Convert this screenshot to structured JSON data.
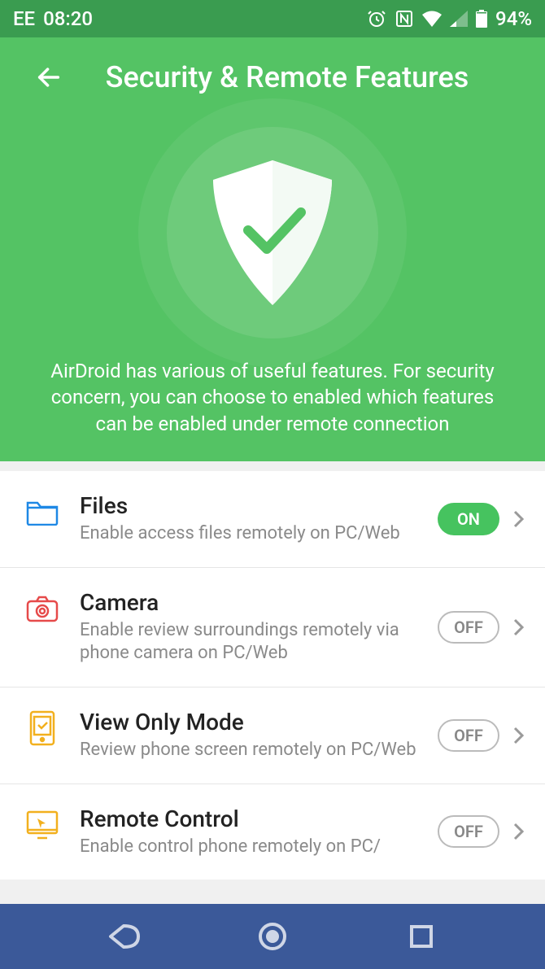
{
  "status_bar": {
    "carrier": "EE",
    "time": "08:20",
    "battery_percent": "94%"
  },
  "header": {
    "title": "Security & Remote Features"
  },
  "hero": {
    "description": "AirDroid has various of useful features. For security concern, you can choose to enabled which features can be enabled under remote connection"
  },
  "features": [
    {
      "title": "Files",
      "description": "Enable access files remotely on PC/Web",
      "toggle_label": "ON",
      "toggle_on": true,
      "icon": "folder",
      "icon_color": "#1e88e5"
    },
    {
      "title": "Camera",
      "description": "Enable review surroundings remotely via phone camera on PC/Web",
      "toggle_label": "OFF",
      "toggle_on": false,
      "icon": "camera",
      "icon_color": "#e64a4a"
    },
    {
      "title": "View Only Mode",
      "description": "Review phone screen remotely on PC/Web",
      "toggle_label": "OFF",
      "toggle_on": false,
      "icon": "phone-check",
      "icon_color": "#f2b01e"
    },
    {
      "title": "Remote Control",
      "description": "Enable control phone remotely on PC/",
      "toggle_label": "OFF",
      "toggle_on": false,
      "icon": "monitor-cursor",
      "icon_color": "#f2b01e"
    }
  ]
}
